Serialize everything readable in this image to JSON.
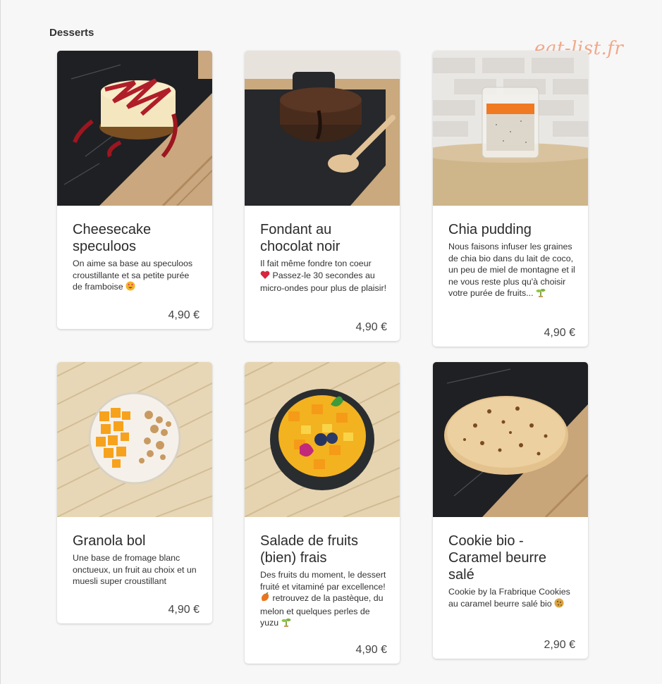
{
  "section": {
    "title": "Desserts"
  },
  "watermark": "eat-list.fr",
  "items": [
    {
      "name": "Cheesecake speculoos",
      "desc": "On aime sa base au speculoos croustillante et sa petite purée de framboise",
      "emoji": "heart-eyes-emoji",
      "price": "4,90 €"
    },
    {
      "name": "Fondant au chocolat noir",
      "desc_a": "Il fait même fondre ton coeur",
      "emoji": "red-heart-emoji",
      "desc_b": "Passez-le 30 secondes au micro-ondes pour plus de plaisir!",
      "price": "4,90 €"
    },
    {
      "name": "Chia pudding",
      "desc": "Nous faisons infuser les graines de chia bio dans du lait de coco, un peu de miel de montagne et il ne vous reste plus qu'à choisir votre purée de fruits...",
      "emoji": "sprout-emoji",
      "price": "4,90 €"
    },
    {
      "name": "Granola bol",
      "desc": "Une base de fromage blanc onctueux, un fruit au choix et un muesli super croustillant",
      "price": "4,90 €"
    },
    {
      "name": "Salade de fruits (bien) frais",
      "desc_a": "Des fruits du moment, le dessert fruité et vitaminé par excellence!",
      "emoji_a": "mango-emoji",
      "desc_b": "retrouvez de la pastèque, du melon et quelques perles de yuzu",
      "emoji_b": "sprout-emoji",
      "price": "4,90 €"
    },
    {
      "name": "Cookie bio - Caramel beurre salé",
      "desc": "Cookie by la Frabrique Cookies au caramel beurre salé bio",
      "emoji": "cookie-emoji",
      "price": "2,90 €"
    }
  ]
}
